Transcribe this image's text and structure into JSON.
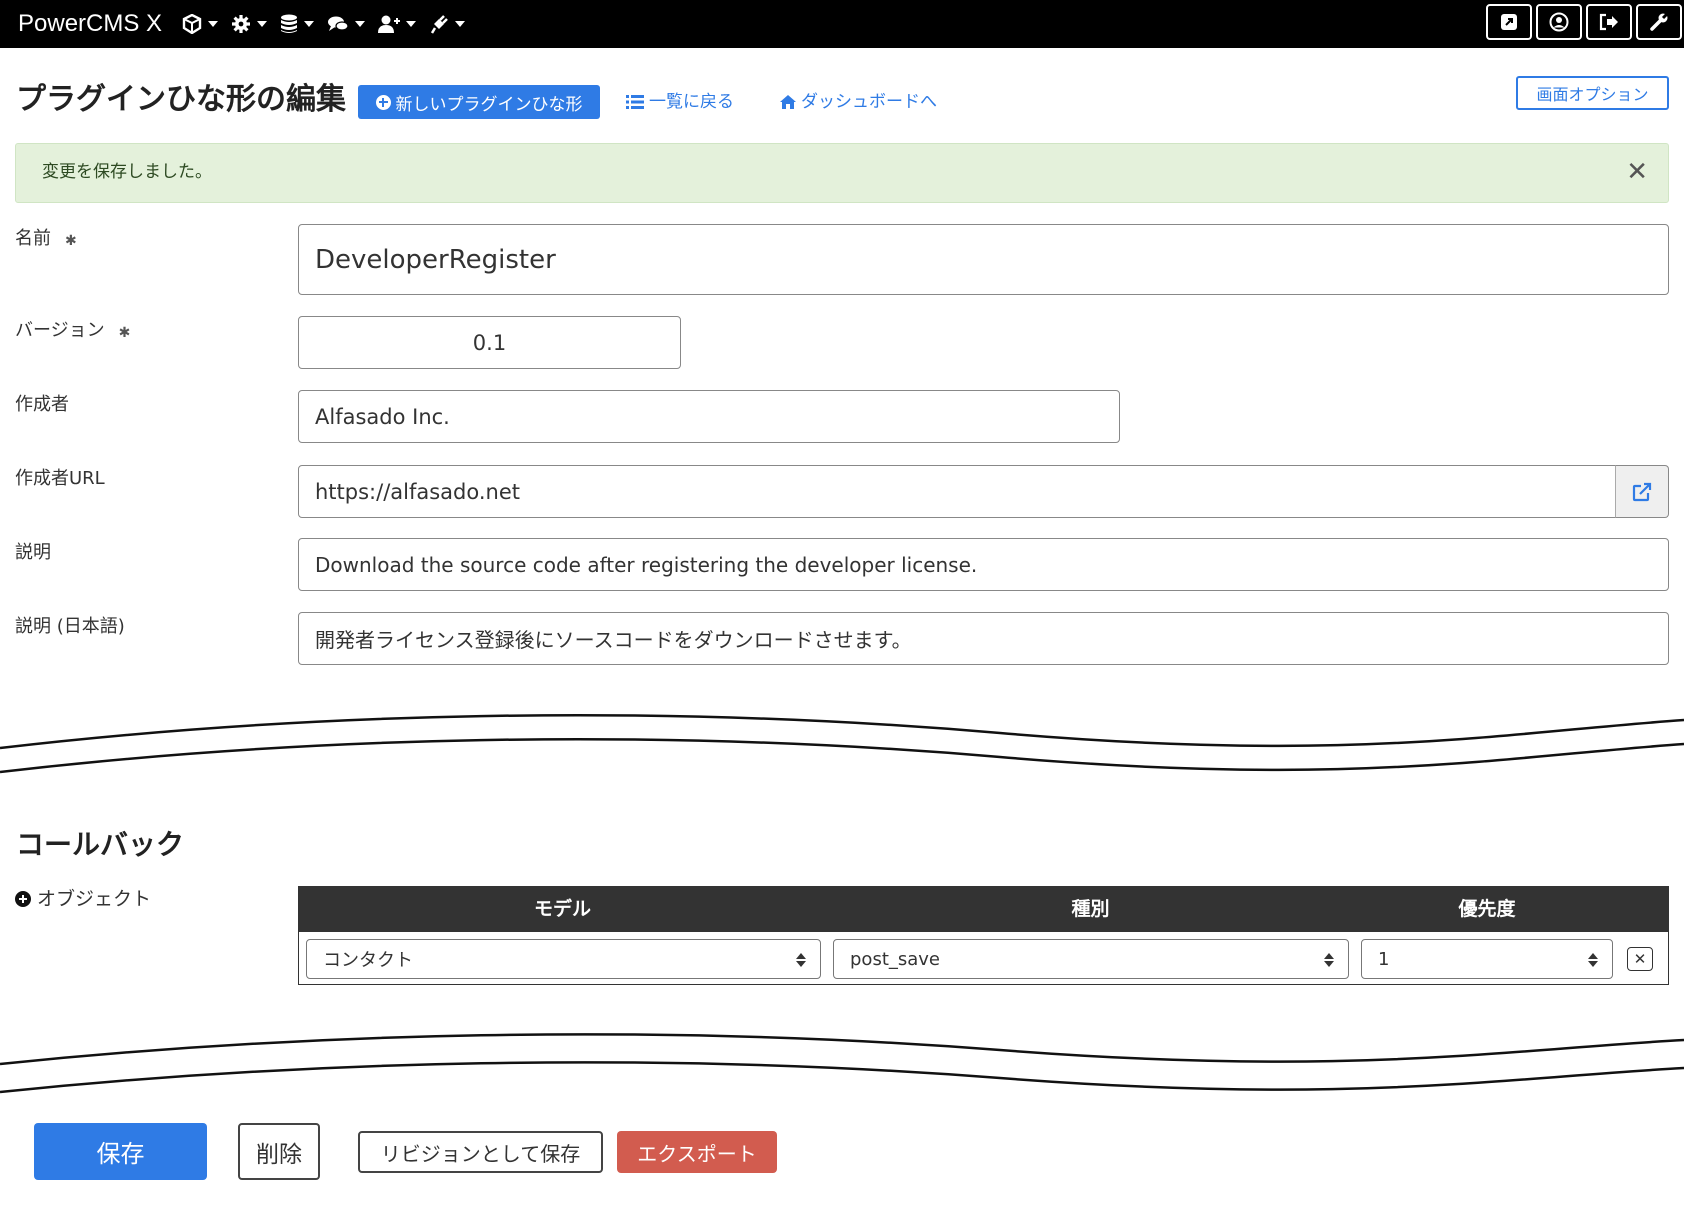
{
  "navbar": {
    "brand": "PowerCMS X",
    "menus": [
      {
        "icon": "cube-icon"
      },
      {
        "icon": "gear-icon"
      },
      {
        "icon": "database-icon"
      },
      {
        "icon": "comments-icon"
      },
      {
        "icon": "user-plus-icon"
      },
      {
        "icon": "plug-icon"
      }
    ],
    "right_buttons": [
      {
        "icon": "external-view-icon"
      },
      {
        "icon": "user-circle-icon"
      },
      {
        "icon": "sign-out-icon"
      },
      {
        "icon": "wrench-icon"
      }
    ]
  },
  "header": {
    "title": "プラグインひな形の編集",
    "new_button": "新しいプラグインひな形",
    "back_to_list": "一覧に戻る",
    "to_dashboard": "ダッシュボードへ",
    "screen_options": "画面オプション"
  },
  "alert": {
    "message": "変更を保存しました。",
    "close": "✕"
  },
  "form": {
    "name": {
      "label": "名前",
      "required_mark": "✱",
      "value": "DeveloperRegister"
    },
    "version": {
      "label": "バージョン",
      "required_mark": "✱",
      "value": "0.1"
    },
    "author": {
      "label": "作成者",
      "value": "Alfasado Inc."
    },
    "author_url": {
      "label": "作成者URL",
      "value": "https://alfasado.net"
    },
    "description": {
      "label": "説明",
      "value": "Download the source code after registering the developer license."
    },
    "description_ja": {
      "label": "説明 (日本語)",
      "value": "開発者ライセンス登録後にソースコードをダウンロードさせます。"
    }
  },
  "callbacks": {
    "title": "コールバック",
    "object_label": "オブジェクト",
    "columns": {
      "model": "モデル",
      "kind": "種別",
      "priority": "優先度"
    },
    "rows": [
      {
        "model": "コンタクト",
        "kind": "post_save",
        "priority": "1",
        "delete": "✕"
      }
    ]
  },
  "actions": {
    "save": "保存",
    "delete": "削除",
    "save_revision": "リビジョンとして保存",
    "export": "エクスポート"
  },
  "colors": {
    "primary": "#2f7be5",
    "danger": "#d25c4f",
    "alert_bg": "#e4f1db",
    "navbar": "#000000"
  }
}
